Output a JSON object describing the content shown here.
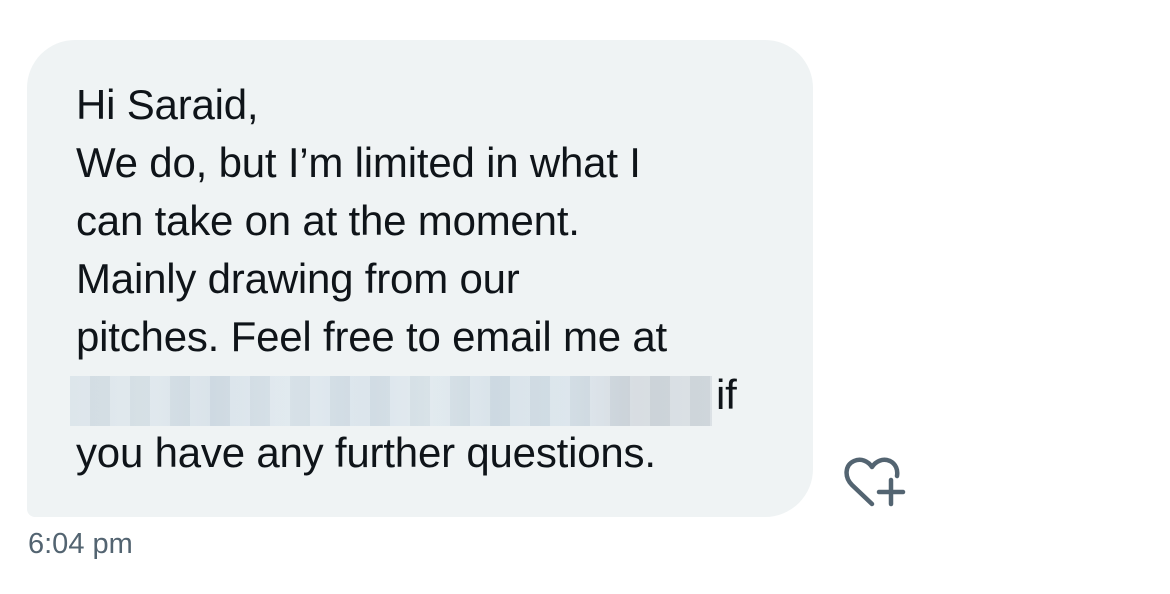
{
  "message": {
    "lines": [
      "Hi Saraid,",
      "We do, but I’m limited in what I",
      "can take on at the moment.",
      "Mainly drawing from our",
      "pitches. Feel free to email me at"
    ],
    "after_redaction": "if",
    "last_line": "you have any further questions.",
    "timestamp": "6:04 pm"
  },
  "icons": {
    "react": "heart-plus-icon"
  },
  "colors": {
    "bubble_bg": "#eff3f4",
    "text": "#0f1419",
    "secondary_text": "#536471",
    "icon": "#536471"
  }
}
